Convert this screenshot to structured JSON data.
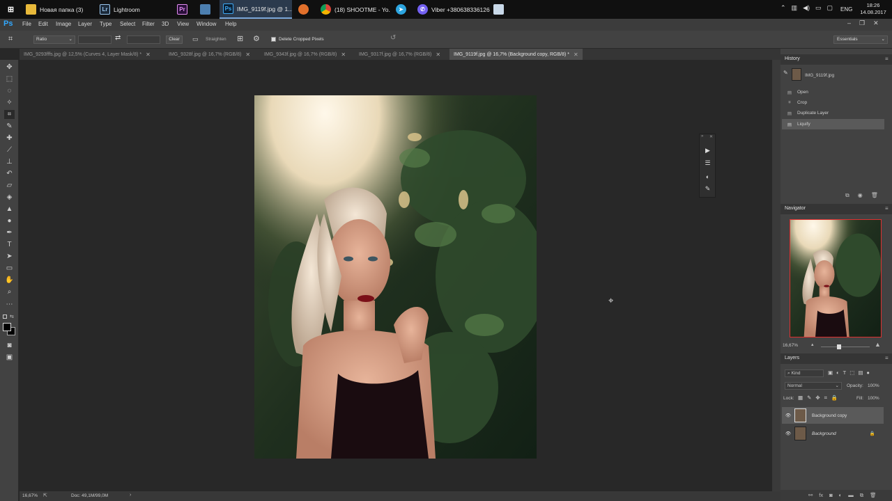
{
  "taskbar": {
    "items": [
      {
        "label": "Новая папка (3)"
      },
      {
        "label": "Lightroom"
      },
      {
        "label": ""
      },
      {
        "label": ""
      },
      {
        "label": "IMG_9119f.jpg @ 1..."
      },
      {
        "label": ""
      },
      {
        "label": "(18) SHOOTME - Yo..."
      },
      {
        "label": ""
      },
      {
        "label": "Viber +380638336126"
      },
      {
        "label": ""
      }
    ],
    "tray": {
      "lang": "ENG",
      "time": "18:26",
      "date": "14.08.2017"
    }
  },
  "menubar": {
    "app_logo": "Ps",
    "items": [
      "File",
      "Edit",
      "Image",
      "Layer",
      "Type",
      "Select",
      "Filter",
      "3D",
      "View",
      "Window",
      "Help"
    ]
  },
  "options": {
    "ratio": "Ratio",
    "clear": "Clear",
    "straighten": "Straighten",
    "delete_cropped": "Delete Cropped Pixels",
    "workspace": "Essentials"
  },
  "doc_tabs": [
    {
      "label": "IMG_9293fffs.jpg @ 12,5% (Curves 4, Layer Mask/8) *",
      "active": false
    },
    {
      "label": "IMG_9328f.jpg @ 16,7% (RGB/8)",
      "active": false
    },
    {
      "label": "IMG_9343f.jpg @ 16,7% (RGB/8)",
      "active": false
    },
    {
      "label": "IMG_9317f.jpg @ 16,7% (RGB/8)",
      "active": false
    },
    {
      "label": "IMG_9119f.jpg @ 16,7% (Background copy, RGB/8) *",
      "active": true
    }
  ],
  "history": {
    "title": "History",
    "snapshot": "IMG_9119f.jpg",
    "items": [
      "Open",
      "Crop",
      "Duplicate Layer",
      "Liquify"
    ],
    "selected": 3
  },
  "navigator": {
    "title": "Navigator",
    "zoom": "16,67%"
  },
  "layers": {
    "title": "Layers",
    "filter_kind": "Kind",
    "blend_mode": "Normal",
    "opacity_label": "Opacity:",
    "opacity": "100%",
    "lock_label": "Lock:",
    "fill_label": "Fill:",
    "fill": "100%",
    "items": [
      {
        "name": "Background copy",
        "selected": true,
        "locked": false
      },
      {
        "name": "Background",
        "selected": false,
        "locked": true
      }
    ]
  },
  "status": {
    "zoom": "16,67%",
    "doc": "Doc: 49,1M/99,0M"
  },
  "colors": {
    "accent": "#2b3a4d",
    "panel": "#424242",
    "canvas": "#282828",
    "navigator_frame": "#e03030"
  }
}
